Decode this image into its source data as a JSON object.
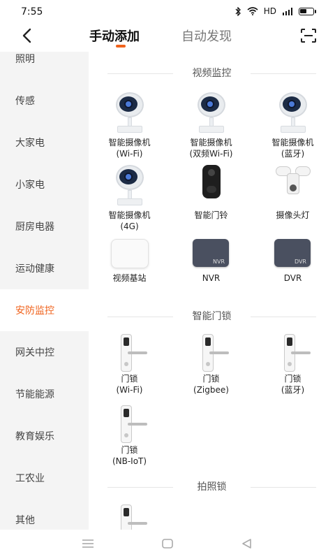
{
  "status": {
    "time": "7:55",
    "network": "HD"
  },
  "header": {
    "tabs": [
      {
        "label": "手动添加",
        "active": true
      },
      {
        "label": "自动发现",
        "active": false
      }
    ],
    "accent": "#f0631d"
  },
  "sidebar": {
    "items": [
      {
        "label": "照明"
      },
      {
        "label": "传感"
      },
      {
        "label": "大家电"
      },
      {
        "label": "小家电"
      },
      {
        "label": "厨房电器"
      },
      {
        "label": "运动健康"
      },
      {
        "label": "安防监控",
        "active": true
      },
      {
        "label": "网关中控"
      },
      {
        "label": "节能能源"
      },
      {
        "label": "教育娱乐"
      },
      {
        "label": "工农业"
      },
      {
        "label": "其他"
      }
    ]
  },
  "sections": {
    "video": {
      "title": "视频监控",
      "items": [
        {
          "line1": "智能摄像机",
          "line2": "(Wi-Fi)",
          "icon": "camera-icon"
        },
        {
          "line1": "智能摄像机",
          "line2": "(双频Wi-Fi)",
          "icon": "camera-icon"
        },
        {
          "line1": "智能摄像机",
          "line2": "(蓝牙)",
          "icon": "camera-icon"
        },
        {
          "line1": "智能摄像机",
          "line2": "(4G)",
          "icon": "camera-icon"
        },
        {
          "line1": "智能门铃",
          "line2": "",
          "icon": "doorbell-icon"
        },
        {
          "line1": "摄像头灯",
          "line2": "",
          "icon": "floodlight-camera-icon"
        },
        {
          "line1": "视频基站",
          "line2": "",
          "icon": "base-station-icon"
        },
        {
          "line1": "NVR",
          "line2": "",
          "icon": "nvr-icon",
          "tag": "NVR"
        },
        {
          "line1": "DVR",
          "line2": "",
          "icon": "dvr-icon",
          "tag": "DVR"
        }
      ]
    },
    "lock": {
      "title": "智能门锁",
      "items": [
        {
          "line1": "门锁",
          "line2": "(Wi-Fi)",
          "icon": "door-lock-icon"
        },
        {
          "line1": "门锁",
          "line2": "(Zigbee)",
          "icon": "door-lock-icon"
        },
        {
          "line1": "门锁",
          "line2": "(蓝牙)",
          "icon": "door-lock-icon"
        },
        {
          "line1": "门锁",
          "line2": "(NB-IoT)",
          "icon": "door-lock-icon"
        }
      ]
    },
    "photo_lock": {
      "title": "拍照锁"
    }
  }
}
